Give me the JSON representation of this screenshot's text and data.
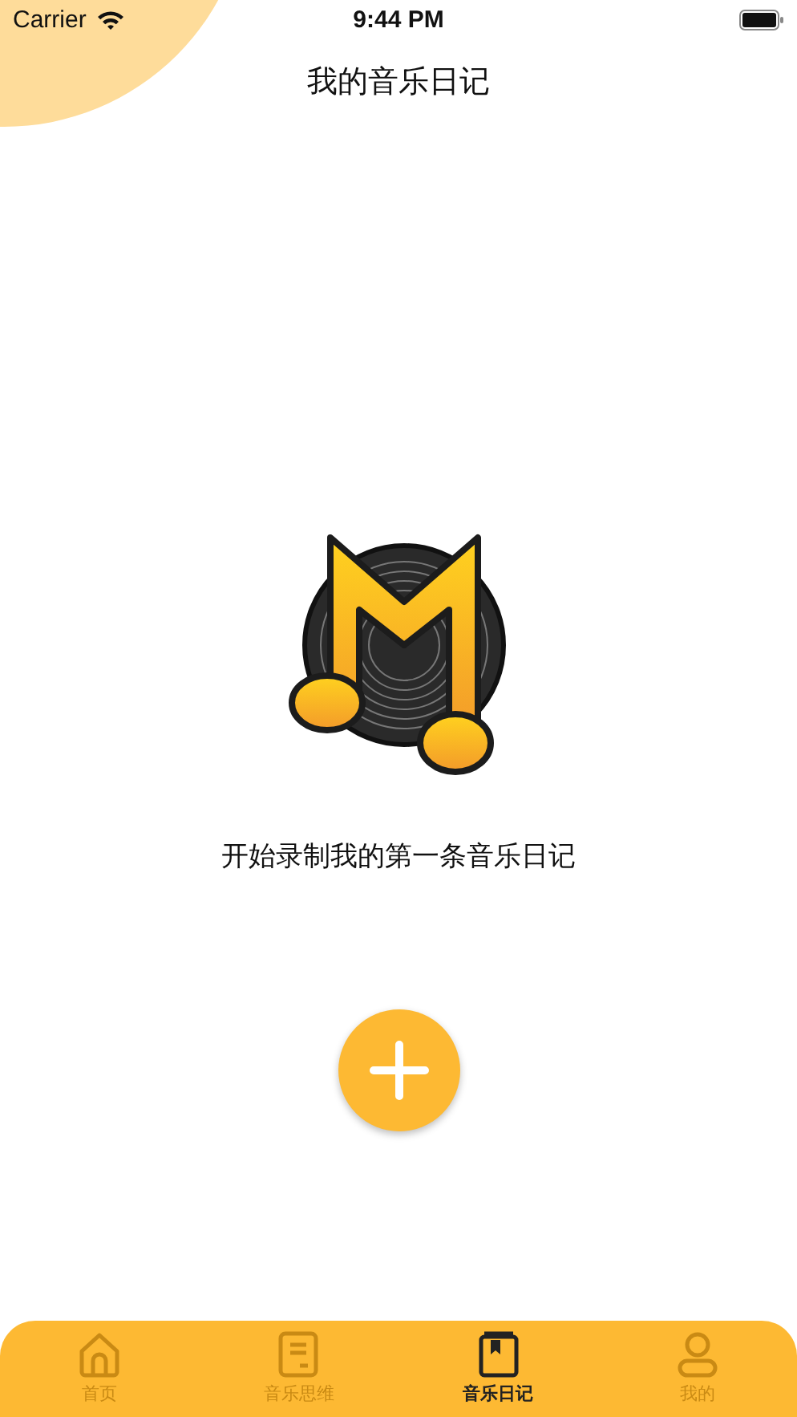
{
  "status_bar": {
    "carrier": "Carrier",
    "time": "9:44 PM"
  },
  "title": "我的音乐日记",
  "empty_state": {
    "message": "开始录制我的第一条音乐日记"
  },
  "tab_bar": [
    {
      "kind": "home",
      "label": "首页",
      "selected": false
    },
    {
      "kind": "document",
      "label": "音乐思维",
      "selected": false
    },
    {
      "kind": "book",
      "label": "音乐日记",
      "selected": true
    },
    {
      "kind": "person",
      "label": "我的",
      "selected": false
    }
  ]
}
